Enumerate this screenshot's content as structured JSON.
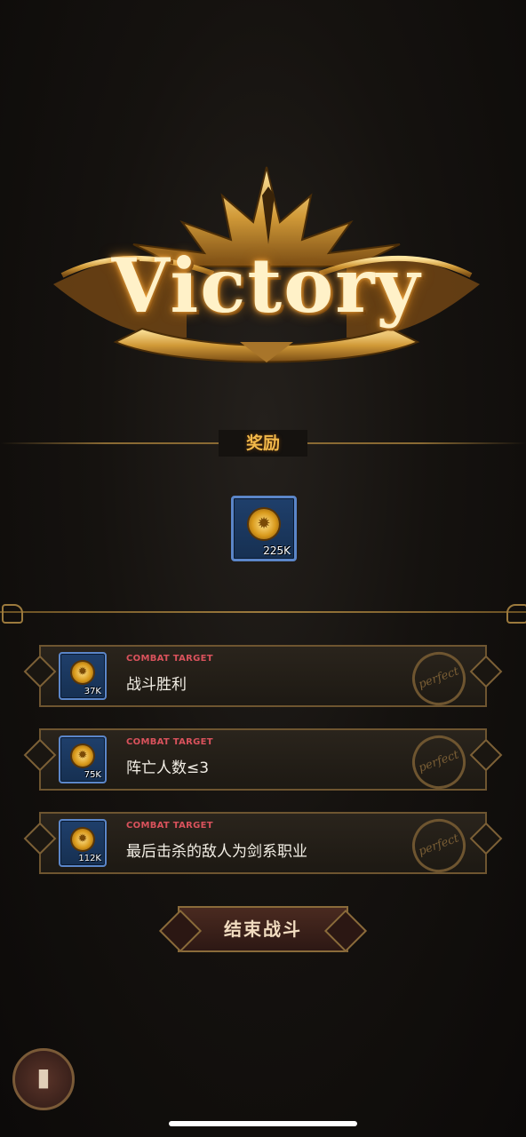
{
  "banner": {
    "title": "Victory"
  },
  "reward_section": {
    "title": "奖励",
    "item": {
      "icon": "gold-coin-icon",
      "quantity": "225K"
    }
  },
  "tasks": [
    {
      "label": "COMBAT TARGET",
      "text": "战斗胜利",
      "reward_qty": "37K",
      "stamp": "perfect"
    },
    {
      "label": "COMBAT TARGET",
      "text": "阵亡人数≤3",
      "reward_qty": "75K",
      "stamp": "perfect"
    },
    {
      "label": "COMBAT TARGET",
      "text": "最后击杀的敌人为剑系职业",
      "reward_qty": "112K",
      "stamp": "perfect"
    }
  ],
  "end_button": {
    "label": "结束战斗"
  },
  "colors": {
    "gold": "#f1b84a",
    "tile_blue": "#5b86c9",
    "target_red": "#d9525c"
  }
}
